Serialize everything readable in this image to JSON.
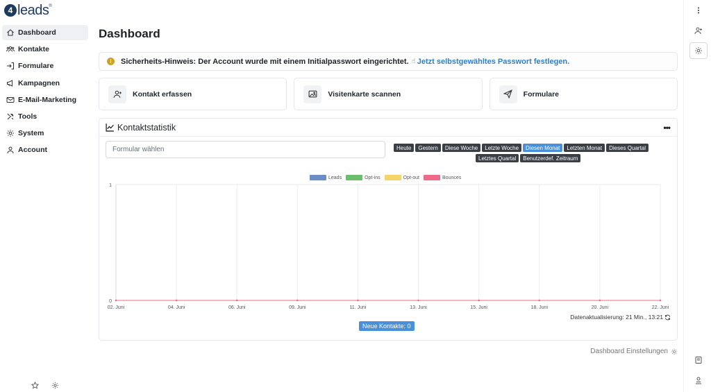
{
  "logo": {
    "mark": "4",
    "text": "leads",
    "sup": "®"
  },
  "sidebar": {
    "items": [
      {
        "label": "Dashboard",
        "icon": "home-icon"
      },
      {
        "label": "Kontakte",
        "icon": "users-icon"
      },
      {
        "label": "Formulare",
        "icon": "form-arrow-icon"
      },
      {
        "label": "Kampagnen",
        "icon": "megaphone-icon"
      },
      {
        "label": "E-Mail-Marketing",
        "icon": "mail-icon"
      },
      {
        "label": "Tools",
        "icon": "tools-icon"
      },
      {
        "label": "System",
        "icon": "gear-icon"
      },
      {
        "label": "Account",
        "icon": "user-icon"
      }
    ],
    "bottom_icons": [
      "star-icon",
      "gear-icon"
    ]
  },
  "page": {
    "title": "Dashboard"
  },
  "alert": {
    "text": "Sicherheits-Hinweis: Der Account wurde mit einem Initialpasswort eingerichtet.",
    "link": "Jetzt selbstgewähltes Passwort festlegen.",
    "icon": "info-icon",
    "link_icon": "hand-pointer-icon"
  },
  "cards": [
    {
      "label": "Kontakt erfassen",
      "icon": "user-plus-icon"
    },
    {
      "label": "Visitenkarte scannen",
      "icon": "image-icon"
    },
    {
      "label": "Formulare",
      "icon": "paper-plane-icon"
    }
  ],
  "stats": {
    "title": "Kontaktstatistik",
    "form_placeholder": "Formular wählen",
    "ranges_row1": [
      "Heute",
      "Gestern",
      "Diese Woche",
      "Letzte Woche",
      "Diesen Monat",
      "Letzten Monat",
      "Dieses Quartal"
    ],
    "ranges_row2": [
      "Letztes Quartal",
      "Benutzerdef. Zeitraum"
    ],
    "active_range": "Diesen Monat",
    "updated": "Datenaktualisierung: 21 Min., 13:21",
    "new_contacts": "Neue Kontakte: 0"
  },
  "chart_data": {
    "type": "line",
    "x": [
      "02. Juni",
      "04. Juni",
      "06. Juni",
      "09. Juni",
      "11. Juni",
      "13. Juni",
      "15. Juni",
      "18. Juni",
      "20. Juni",
      "22. Juni"
    ],
    "ylim": [
      0,
      1
    ],
    "yticks": [
      "1",
      "0"
    ],
    "series": [
      {
        "name": "Leads",
        "color": "#6b8cc7",
        "values": [
          0,
          0,
          0,
          0,
          0,
          0,
          0,
          0,
          0,
          0
        ]
      },
      {
        "name": "Opt-ins",
        "color": "#6cbf6a",
        "values": [
          0,
          0,
          0,
          0,
          0,
          0,
          0,
          0,
          0,
          0
        ]
      },
      {
        "name": "Opt-out",
        "color": "#f7d469",
        "values": [
          0,
          0,
          0,
          0,
          0,
          0,
          0,
          0,
          0,
          0
        ]
      },
      {
        "name": "Bounces",
        "color": "#f06a8a",
        "values": [
          0,
          0,
          0,
          0,
          0,
          0,
          0,
          0,
          0,
          0
        ]
      }
    ],
    "legend": "top-center",
    "grid": true
  },
  "footer": {
    "settings_label": "Dashboard Einstellungen"
  },
  "rail": {
    "icons": [
      "more-vertical-icon",
      "user-plus-icon",
      "gear-icon",
      "book-icon",
      "user-card-icon"
    ]
  }
}
